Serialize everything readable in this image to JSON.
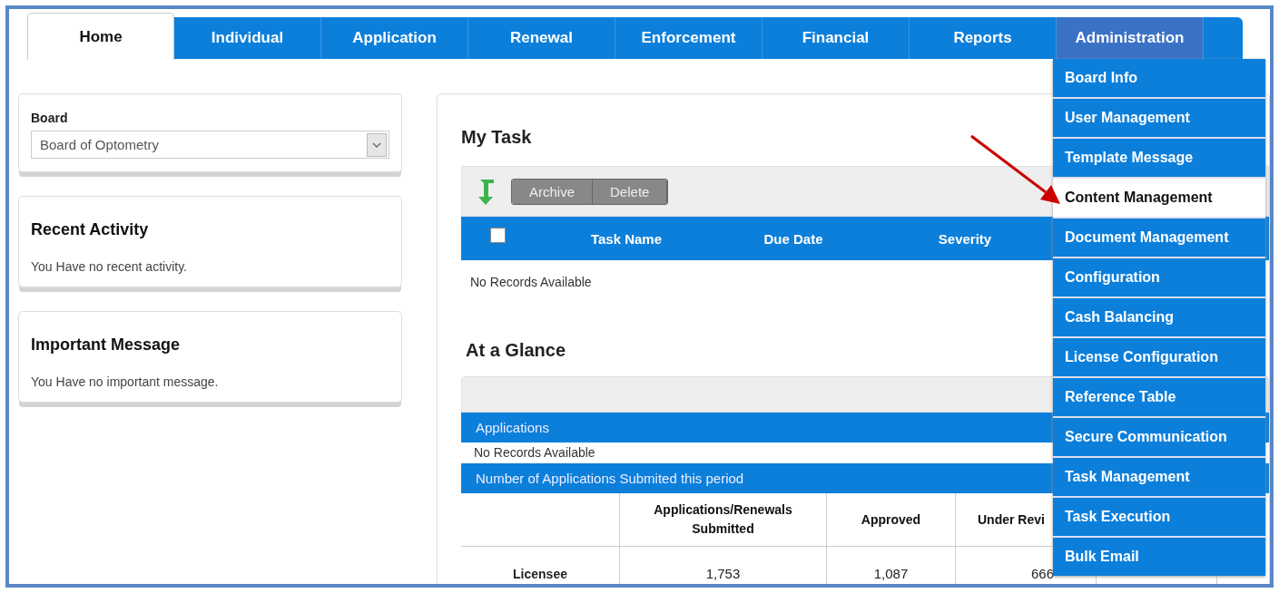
{
  "tabs": [
    {
      "label": "Home",
      "selected": true,
      "expanded": false
    },
    {
      "label": "Individual",
      "selected": false,
      "expanded": false
    },
    {
      "label": "Application",
      "selected": false,
      "expanded": false
    },
    {
      "label": "Renewal",
      "selected": false,
      "expanded": false
    },
    {
      "label": "Enforcement",
      "selected": false,
      "expanded": false
    },
    {
      "label": "Financial",
      "selected": false,
      "expanded": false
    },
    {
      "label": "Reports",
      "selected": false,
      "expanded": false
    },
    {
      "label": "Administration",
      "selected": false,
      "expanded": true
    }
  ],
  "admin_menu": [
    {
      "label": "Board Info",
      "selected": false
    },
    {
      "label": "User Management",
      "selected": false
    },
    {
      "label": "Template Message",
      "selected": false
    },
    {
      "label": "Content Management",
      "selected": true
    },
    {
      "label": "Document Management",
      "selected": false
    },
    {
      "label": "Configuration",
      "selected": false
    },
    {
      "label": "Cash Balancing",
      "selected": false
    },
    {
      "label": "License Configuration",
      "selected": false
    },
    {
      "label": "Reference Table",
      "selected": false
    },
    {
      "label": "Secure Communication",
      "selected": false
    },
    {
      "label": "Task Management",
      "selected": false
    },
    {
      "label": "Task Execution",
      "selected": false
    },
    {
      "label": "Bulk Email",
      "selected": false
    }
  ],
  "sidebar": {
    "board": {
      "label": "Board",
      "value": "Board of Optometry"
    },
    "recent_activity": {
      "title": "Recent Activity",
      "text": "You Have no recent activity."
    },
    "important_message": {
      "title": "Important Message",
      "text": "You Have no important message."
    }
  },
  "my_task": {
    "title": "My Task",
    "buttons": [
      "Archive",
      "Delete"
    ],
    "select_all": {
      "checked": false
    },
    "columns": [
      "Task Name",
      "Due Date",
      "Severity"
    ],
    "empty": "No Records Available"
  },
  "at_a_glance": {
    "title": "At a Glance",
    "applications": {
      "title": "Applications",
      "empty": "No Records Available"
    },
    "submitted": {
      "title": "Number of Applications Submited this period",
      "columns": [
        "",
        "Applications/Renewals Submitted",
        "Approved",
        "Under Revi"
      ],
      "rows": [
        [
          "Licensee",
          "1,753",
          "1,087",
          "666"
        ]
      ]
    }
  }
}
